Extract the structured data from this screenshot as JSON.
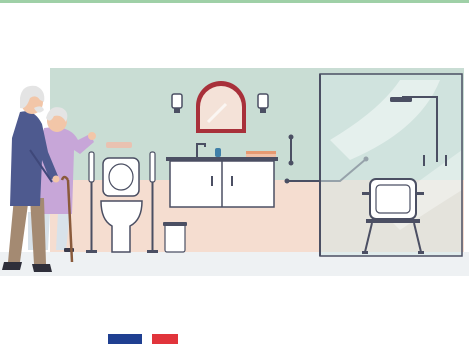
{
  "illustration": {
    "subject": "elderly-couple-in-accessible-bathroom",
    "icons": [
      "elderly-man-icon",
      "elderly-woman-icon",
      "walking-cane-icon",
      "toilet-icon",
      "grab-bar-icon",
      "sink-cabinet-icon",
      "mirror-icon",
      "wall-lamp-icon",
      "shower-icon",
      "shower-seat-icon",
      "waste-bin-icon"
    ]
  },
  "colors": {
    "top_rule": "#9fd0a7",
    "wall_upper": "#c9ddd4",
    "wall_lower": "#f5ddd0",
    "floor": "#eef1f3",
    "mirror_frame": "#a8303a",
    "mirror_glass": "#f4e2d8",
    "cabinet": "#ffffff",
    "fixture_outline": "#4b4f63",
    "glass": "#d6e8e6",
    "man_coat": "#4e5a8f",
    "woman_coat": "#c7a6d8",
    "hair": "#e4e4e4",
    "skin": "#f2c6a8",
    "trousers": "#a48a72",
    "flag_blue": "#1f3f91",
    "flag_white": "#ffffff",
    "flag_red": "#e1343b"
  }
}
